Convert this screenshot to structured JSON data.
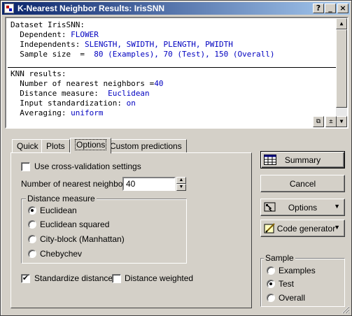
{
  "window": {
    "title": "K-Nearest Neighbor Results: IrisSNN",
    "help_btn": "?",
    "min_btn": "_",
    "close_btn": "×"
  },
  "output": {
    "line1": "Dataset IrisSNN:",
    "dependent_label": "  Dependent: ",
    "dependent_value": "FLOWER",
    "independents_label": "  Independents: ",
    "independents_value": "SLENGTH, SWIDTH, PLENGTH, PWIDTH",
    "sample_label": "  Sample size  =  ",
    "sample_value": "80 (Examples), 70 (Test), 150 (Overall)",
    "knn_header": "KNN results:",
    "neighbors_label": "  Number of nearest neighbors =",
    "neighbors_value": "40",
    "distance_label": "  Distance measure:  ",
    "distance_value": "Euclidean",
    "standardization_label": "  Input standardization: ",
    "standardization_value": "on",
    "averaging_label": "  Averaging: ",
    "averaging_value": "uniform"
  },
  "tabs": [
    {
      "label": "Quick"
    },
    {
      "label": "Plots"
    },
    {
      "label": "Options"
    },
    {
      "label": "Custom predictions"
    }
  ],
  "options": {
    "cross_validation_label": "Use cross-validation settings",
    "cross_validation_checked": false,
    "neighbors_label": "Number of nearest neighbors:",
    "neighbors_value": "40",
    "distance_group_title": "Distance measure",
    "distance_options": [
      {
        "label": "Euclidean",
        "selected": true
      },
      {
        "label": "Euclidean squared",
        "selected": false
      },
      {
        "label": "City-block (Manhattan)",
        "selected": false
      },
      {
        "label": "Chebychev",
        "selected": false
      }
    ],
    "standardize_label": "Standardize distances",
    "standardize_checked": true,
    "distance_weighted_label": "Distance weighted",
    "distance_weighted_checked": false
  },
  "buttons": {
    "summary": "Summary",
    "cancel": "Cancel",
    "options": "Options",
    "code_generator": "Code generator"
  },
  "sample": {
    "title": "Sample",
    "items": [
      {
        "label": "Examples",
        "selected": false
      },
      {
        "label": "Test",
        "selected": true
      },
      {
        "label": "Overall",
        "selected": false
      }
    ]
  },
  "icons": {
    "app": "statistica-app-icon",
    "summary": "spreadsheet-icon",
    "options": "options-icon",
    "code_generator": "pencil-notepad-icon"
  }
}
